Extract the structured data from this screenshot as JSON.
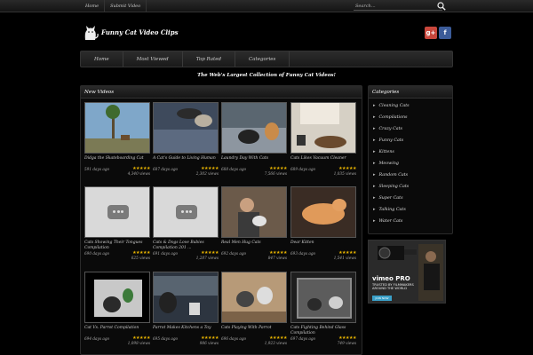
{
  "topnav": [
    "Home",
    "Submit Video"
  ],
  "search": {
    "placeholder": "Search..."
  },
  "site": {
    "title": "Funny Cat Video Clips",
    "tagline": "The Web's Largest Collection of Funny Cat Videos!"
  },
  "social": {
    "gplus": "g+",
    "facebook": "f"
  },
  "mainnav": [
    "Home",
    "Most Viewed",
    "Top Rated",
    "Categories"
  ],
  "videos_heading": "New Videos",
  "videos": [
    {
      "title": "Didga the Skateboarding Cat",
      "ago": "591 days ago",
      "views": "4,340 views",
      "thumb": "skate"
    },
    {
      "title": "A Cat's Guide to Living Human",
      "ago": "687 days ago",
      "views": "2,302 views",
      "thumb": "bed"
    },
    {
      "title": "Laundry Day With Cats",
      "ago": "688 days ago",
      "views": "7,566 views",
      "thumb": "laundry"
    },
    {
      "title": "Cats Likes Vacuum Cleaner",
      "ago": "689 days ago",
      "views": "1,035 views",
      "thumb": "vacuum"
    },
    {
      "title": "Cats Showing Their Tongues Compilation",
      "ago": "690 days ago",
      "views": "625 views",
      "thumb": "placeholder"
    },
    {
      "title": "Cats & Dogs Love Babies Compilation 201 ...",
      "ago": "691 days ago",
      "views": "1,287 views",
      "thumb": "placeholder"
    },
    {
      "title": "Real Men Hug Cats",
      "ago": "692 days ago",
      "views": "847 views",
      "thumb": "hug"
    },
    {
      "title": "Dear Kitten",
      "ago": "693 days ago",
      "views": "1,541 views",
      "thumb": "kitten"
    },
    {
      "title": "Cat Vs. Parrot Compilation",
      "ago": "694 days ago",
      "views": "1,098 views",
      "thumb": "parrot"
    },
    {
      "title": "Parrot Makes Kitchens a Toy",
      "ago": "695 days ago",
      "views": "986 views",
      "thumb": "kitchen"
    },
    {
      "title": "Cats Playing With Parrot",
      "ago": "696 days ago",
      "views": "1,923 views",
      "thumb": "playing"
    },
    {
      "title": "Cats Fighting Behind Glass Compilation",
      "ago": "697 days ago",
      "views": "749 views",
      "thumb": "glass"
    }
  ],
  "sidebar": {
    "heading": "Categories",
    "categories": [
      "Cleaning Cats",
      "Compilations",
      "Crazy Cats",
      "Funny Cats",
      "Kittens",
      "Meowing",
      "Random Cats",
      "Sleeping Cats",
      "Super Cats",
      "Talking Cats",
      "Water Cats"
    ]
  },
  "ad": {
    "brand": "vimeo PRO",
    "text": "TRUSTED BY FILMMAKERS AROUND THE WORLD",
    "button": "JOIN NOW"
  },
  "colors": {
    "star": "#e8b400",
    "background": "#000000"
  }
}
